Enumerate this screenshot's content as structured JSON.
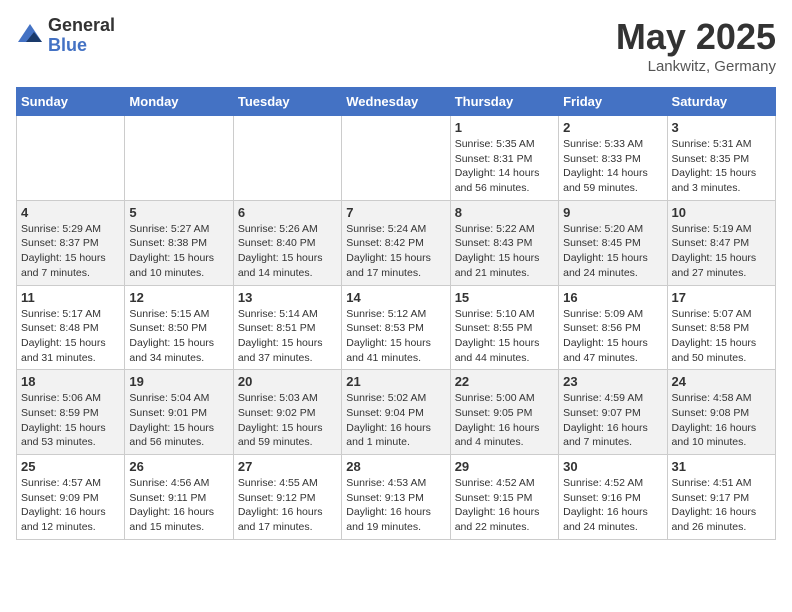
{
  "logo": {
    "general": "General",
    "blue": "Blue"
  },
  "title": {
    "month": "May 2025",
    "location": "Lankwitz, Germany"
  },
  "weekdays": [
    "Sunday",
    "Monday",
    "Tuesday",
    "Wednesday",
    "Thursday",
    "Friday",
    "Saturday"
  ],
  "weeks": [
    [
      {
        "day": "",
        "info": ""
      },
      {
        "day": "",
        "info": ""
      },
      {
        "day": "",
        "info": ""
      },
      {
        "day": "",
        "info": ""
      },
      {
        "day": "1",
        "info": "Sunrise: 5:35 AM\nSunset: 8:31 PM\nDaylight: 14 hours\nand 56 minutes."
      },
      {
        "day": "2",
        "info": "Sunrise: 5:33 AM\nSunset: 8:33 PM\nDaylight: 14 hours\nand 59 minutes."
      },
      {
        "day": "3",
        "info": "Sunrise: 5:31 AM\nSunset: 8:35 PM\nDaylight: 15 hours\nand 3 minutes."
      }
    ],
    [
      {
        "day": "4",
        "info": "Sunrise: 5:29 AM\nSunset: 8:37 PM\nDaylight: 15 hours\nand 7 minutes."
      },
      {
        "day": "5",
        "info": "Sunrise: 5:27 AM\nSunset: 8:38 PM\nDaylight: 15 hours\nand 10 minutes."
      },
      {
        "day": "6",
        "info": "Sunrise: 5:26 AM\nSunset: 8:40 PM\nDaylight: 15 hours\nand 14 minutes."
      },
      {
        "day": "7",
        "info": "Sunrise: 5:24 AM\nSunset: 8:42 PM\nDaylight: 15 hours\nand 17 minutes."
      },
      {
        "day": "8",
        "info": "Sunrise: 5:22 AM\nSunset: 8:43 PM\nDaylight: 15 hours\nand 21 minutes."
      },
      {
        "day": "9",
        "info": "Sunrise: 5:20 AM\nSunset: 8:45 PM\nDaylight: 15 hours\nand 24 minutes."
      },
      {
        "day": "10",
        "info": "Sunrise: 5:19 AM\nSunset: 8:47 PM\nDaylight: 15 hours\nand 27 minutes."
      }
    ],
    [
      {
        "day": "11",
        "info": "Sunrise: 5:17 AM\nSunset: 8:48 PM\nDaylight: 15 hours\nand 31 minutes."
      },
      {
        "day": "12",
        "info": "Sunrise: 5:15 AM\nSunset: 8:50 PM\nDaylight: 15 hours\nand 34 minutes."
      },
      {
        "day": "13",
        "info": "Sunrise: 5:14 AM\nSunset: 8:51 PM\nDaylight: 15 hours\nand 37 minutes."
      },
      {
        "day": "14",
        "info": "Sunrise: 5:12 AM\nSunset: 8:53 PM\nDaylight: 15 hours\nand 41 minutes."
      },
      {
        "day": "15",
        "info": "Sunrise: 5:10 AM\nSunset: 8:55 PM\nDaylight: 15 hours\nand 44 minutes."
      },
      {
        "day": "16",
        "info": "Sunrise: 5:09 AM\nSunset: 8:56 PM\nDaylight: 15 hours\nand 47 minutes."
      },
      {
        "day": "17",
        "info": "Sunrise: 5:07 AM\nSunset: 8:58 PM\nDaylight: 15 hours\nand 50 minutes."
      }
    ],
    [
      {
        "day": "18",
        "info": "Sunrise: 5:06 AM\nSunset: 8:59 PM\nDaylight: 15 hours\nand 53 minutes."
      },
      {
        "day": "19",
        "info": "Sunrise: 5:04 AM\nSunset: 9:01 PM\nDaylight: 15 hours\nand 56 minutes."
      },
      {
        "day": "20",
        "info": "Sunrise: 5:03 AM\nSunset: 9:02 PM\nDaylight: 15 hours\nand 59 minutes."
      },
      {
        "day": "21",
        "info": "Sunrise: 5:02 AM\nSunset: 9:04 PM\nDaylight: 16 hours\nand 1 minute."
      },
      {
        "day": "22",
        "info": "Sunrise: 5:00 AM\nSunset: 9:05 PM\nDaylight: 16 hours\nand 4 minutes."
      },
      {
        "day": "23",
        "info": "Sunrise: 4:59 AM\nSunset: 9:07 PM\nDaylight: 16 hours\nand 7 minutes."
      },
      {
        "day": "24",
        "info": "Sunrise: 4:58 AM\nSunset: 9:08 PM\nDaylight: 16 hours\nand 10 minutes."
      }
    ],
    [
      {
        "day": "25",
        "info": "Sunrise: 4:57 AM\nSunset: 9:09 PM\nDaylight: 16 hours\nand 12 minutes."
      },
      {
        "day": "26",
        "info": "Sunrise: 4:56 AM\nSunset: 9:11 PM\nDaylight: 16 hours\nand 15 minutes."
      },
      {
        "day": "27",
        "info": "Sunrise: 4:55 AM\nSunset: 9:12 PM\nDaylight: 16 hours\nand 17 minutes."
      },
      {
        "day": "28",
        "info": "Sunrise: 4:53 AM\nSunset: 9:13 PM\nDaylight: 16 hours\nand 19 minutes."
      },
      {
        "day": "29",
        "info": "Sunrise: 4:52 AM\nSunset: 9:15 PM\nDaylight: 16 hours\nand 22 minutes."
      },
      {
        "day": "30",
        "info": "Sunrise: 4:52 AM\nSunset: 9:16 PM\nDaylight: 16 hours\nand 24 minutes."
      },
      {
        "day": "31",
        "info": "Sunrise: 4:51 AM\nSunset: 9:17 PM\nDaylight: 16 hours\nand 26 minutes."
      }
    ]
  ]
}
